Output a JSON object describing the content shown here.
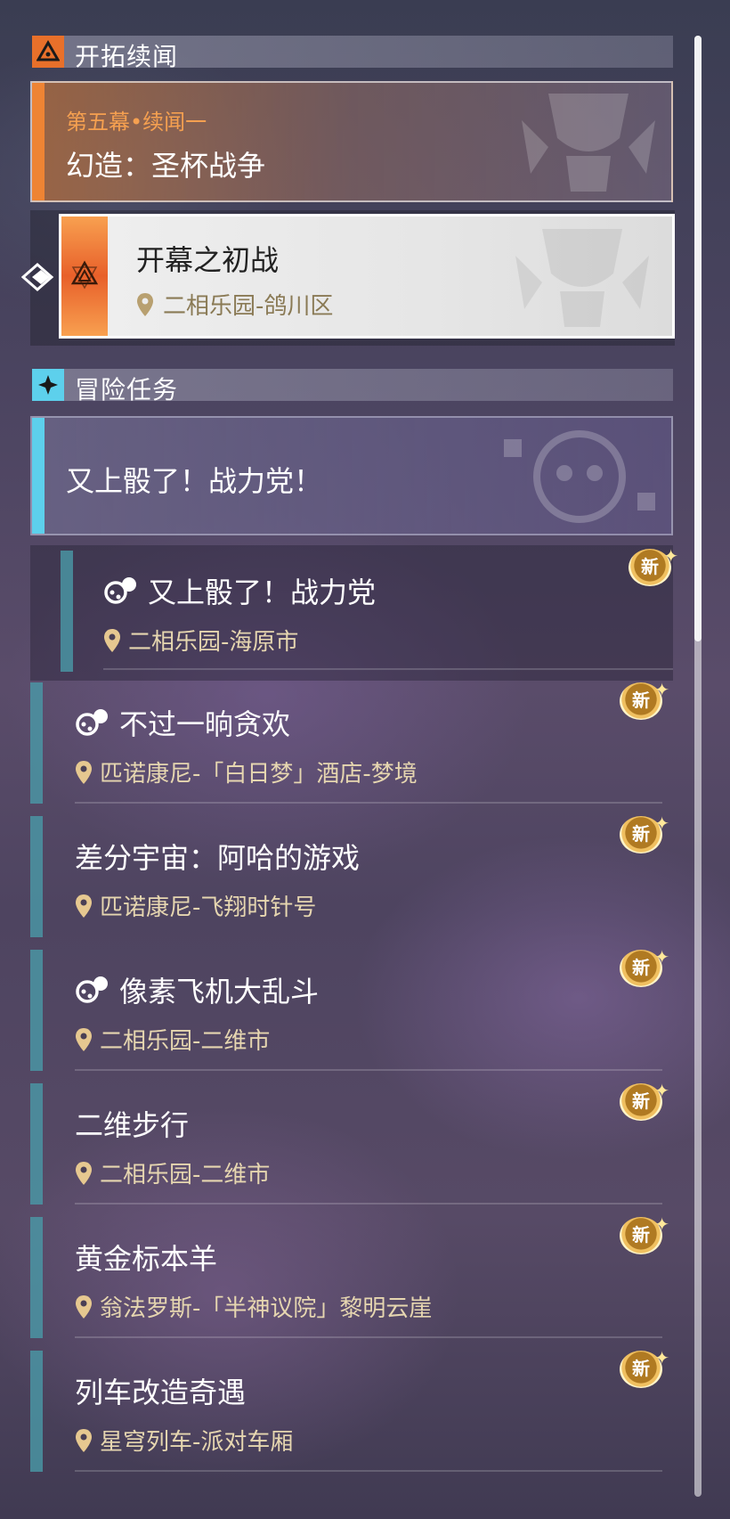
{
  "sections": {
    "trailblaze": {
      "title": "开拓续闻"
    },
    "adventure": {
      "title": "冒险任务"
    }
  },
  "story": {
    "act_label": "第五幕•续闻一",
    "title": "幻造：圣杯战争",
    "selected_quest": {
      "name": "开幕之初战",
      "location": "二相乐园-鸽川区"
    }
  },
  "adventure_group": {
    "title": "又上骰了！战力党！"
  },
  "quests": [
    {
      "name": "又上骰了！战力党",
      "location": "二相乐园-海原市",
      "icon": "dice-icon",
      "badge": "新"
    },
    {
      "name": "不过一晌贪欢",
      "location": "匹诺康尼-「白日梦」酒店-梦境",
      "icon": "dice-icon",
      "badge": "新"
    },
    {
      "name": "差分宇宙：阿哈的游戏",
      "location": "匹诺康尼-飞翔时针号",
      "icon": "",
      "badge": "新"
    },
    {
      "name": "像素飞机大乱斗",
      "location": "二相乐园-二维市",
      "icon": "dice-icon",
      "badge": "新"
    },
    {
      "name": "二维步行",
      "location": "二相乐园-二维市",
      "icon": "",
      "badge": "新"
    },
    {
      "name": "黄金标本羊",
      "location": "翁法罗斯-「半神议院」黎明云崖",
      "icon": "",
      "badge": "新"
    },
    {
      "name": "列车改造奇遇",
      "location": "星穹列车-派对车厢",
      "icon": "",
      "badge": "新"
    }
  ],
  "colors": {
    "story_accent": "#ee8434",
    "adventure_accent": "#5dd0ec",
    "quest_bar": "#4a9aa8",
    "location_text": "#e6d6b0",
    "badge": "#f0c060"
  }
}
